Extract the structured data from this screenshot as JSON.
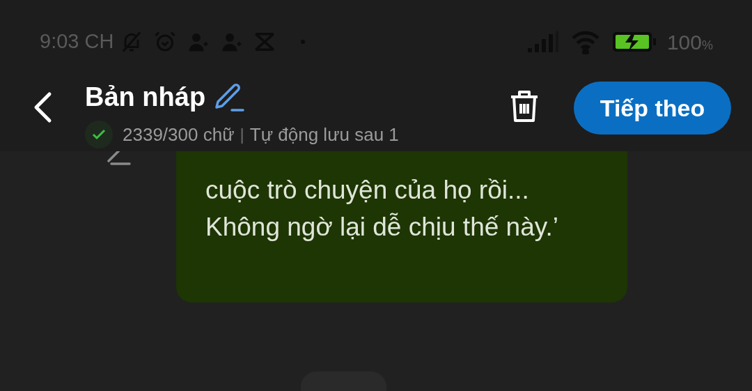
{
  "status_bar": {
    "time": "9:03 CH",
    "battery": "100",
    "battery_unit": "%"
  },
  "header": {
    "title": "Bản nháp",
    "word_count": "2339/300 chữ",
    "separator": "|",
    "autosave": "Tự động lưu sau 1"
  },
  "next_button": {
    "label": "Tiếp theo"
  },
  "message": {
    "text": "cuộc trò chuyện của họ rồi... Không ngờ lại dễ chịu thế này.’"
  }
}
